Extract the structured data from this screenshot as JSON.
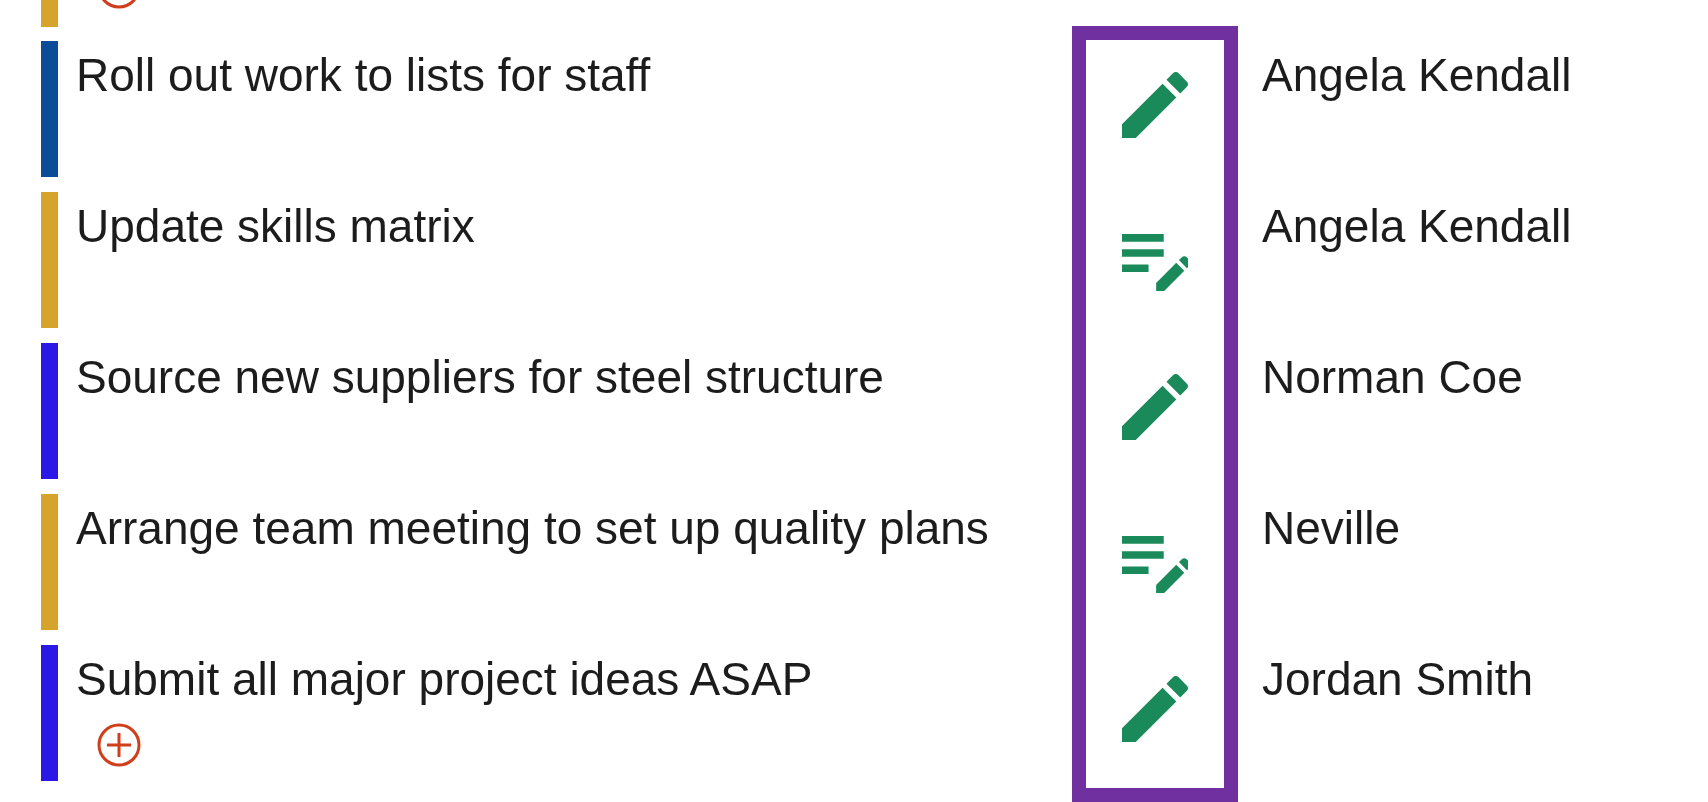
{
  "row_above": {
    "color": "#d6a42b",
    "add_icon": true
  },
  "tasks": [
    {
      "title": "Roll out work to lists for staff",
      "color": "#0b4c99",
      "kind": "edit",
      "assignee": "Angela Kendall",
      "add_icon": false
    },
    {
      "title": "Update skills matrix",
      "color": "#d6a42b",
      "kind": "edit_note",
      "assignee": "Angela Kendall",
      "add_icon": false
    },
    {
      "title": "Source new suppliers for steel structure",
      "color": "#2b17e6",
      "kind": "edit",
      "assignee": "Norman Coe",
      "add_icon": false
    },
    {
      "title": "Arrange team meeting to set up quality plans",
      "color": "#d6a42b",
      "kind": "edit_note",
      "assignee": "Neville",
      "add_icon": false
    },
    {
      "title": "Submit all major project ideas ASAP",
      "color": "#2b17e6",
      "kind": "edit",
      "assignee": "Jordan Smith",
      "add_icon": true
    }
  ]
}
